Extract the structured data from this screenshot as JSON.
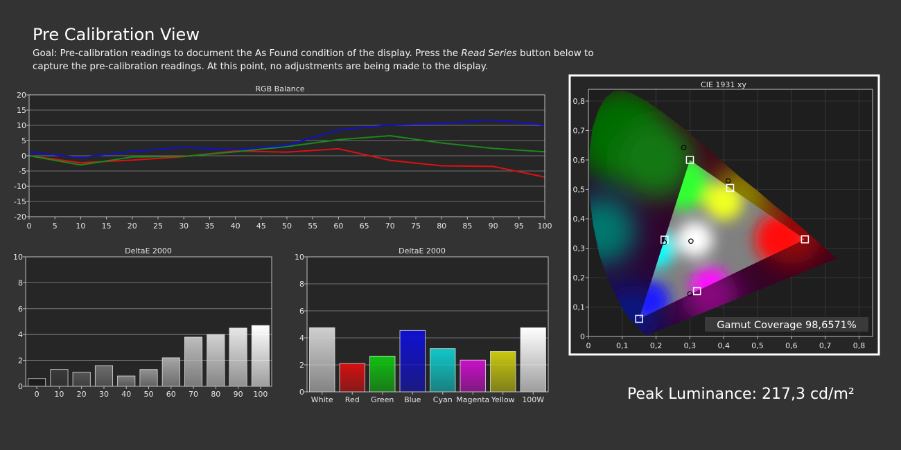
{
  "page": {
    "title": "Pre Calibration View",
    "goal_prefix": "Goal: Pre-calibration readings to document the As Found condition of the display. Press the ",
    "goal_emph": "Read Series",
    "goal_suffix": " button below to capture the pre-calibration readings. At this point, no adjustments are being made to the display.",
    "peak_luminance": "Peak Luminance: 217,3 cd/m²"
  },
  "colors": {
    "background": "#333333",
    "plot_bg": "#262626",
    "red_line": "#e01010",
    "green_line": "#1a8a1a",
    "blue_line": "#1010d0"
  },
  "chart_data": [
    {
      "type": "line",
      "title": "RGB Balance",
      "x": [
        0,
        10,
        20,
        30,
        40,
        50,
        60,
        70,
        80,
        90,
        100
      ],
      "xticks": [
        "0",
        "5",
        "10",
        "15",
        "20",
        "25",
        "30",
        "35",
        "40",
        "45",
        "50",
        "55",
        "60",
        "65",
        "70",
        "75",
        "80",
        "85",
        "90",
        "95",
        "100"
      ],
      "yticks": [
        "20",
        "15",
        "10",
        "5",
        "0",
        "-5",
        "-10",
        "-15",
        "-20"
      ],
      "xlim": [
        0,
        100
      ],
      "ylim": [
        -20,
        20
      ],
      "grid": true,
      "series": [
        {
          "color": "#e01010",
          "values": [
            0,
            -2.3,
            -1.4,
            -0.3,
            1.6,
            1.2,
            2.3,
            -1.5,
            -3.3,
            -3.5,
            -7.0
          ]
        },
        {
          "color": "#1a8a1a",
          "values": [
            0,
            -3.0,
            -0.4,
            -0.2,
            1.3,
            3.0,
            5.3,
            6.6,
            4.2,
            2.4,
            1.3
          ]
        },
        {
          "color": "#1010d0",
          "values": [
            1.2,
            -0.6,
            1.4,
            2.8,
            2.0,
            3.4,
            8.5,
            10.1,
            10.6,
            11.7,
            10.1
          ]
        }
      ]
    },
    {
      "type": "bar",
      "title": "DeltaE 2000",
      "categories": [
        "0",
        "10",
        "20",
        "30",
        "40",
        "50",
        "60",
        "70",
        "80",
        "90",
        "100"
      ],
      "values": [
        0.6,
        1.3,
        1.1,
        1.6,
        0.8,
        1.3,
        2.2,
        3.8,
        4.0,
        4.5,
        4.7
      ],
      "yticks": [
        "10",
        "8",
        "6",
        "4",
        "2",
        "0"
      ],
      "ylim": [
        0,
        10
      ],
      "colors": [
        "#1a1a1a",
        "#3a3a3a",
        "#555555",
        "#6c6c6c",
        "#7e7e7e",
        "#919191",
        "#a6a6a6",
        "#bdbdbd",
        "#d2d2d2",
        "#e6e6e6",
        "#ffffff"
      ],
      "grid": true
    },
    {
      "type": "bar",
      "title": "DeltaE 2000",
      "categories": [
        "White",
        "Red",
        "Green",
        "Blue",
        "Cyan",
        "Magenta",
        "Yellow",
        "100W"
      ],
      "values": [
        4.75,
        2.1,
        2.65,
        4.55,
        3.2,
        2.35,
        3.0,
        4.75
      ],
      "yticks": [
        "10",
        "8",
        "6",
        "4",
        "2",
        "0"
      ],
      "ylim": [
        0,
        10
      ],
      "colors": [
        "#cfcfcf",
        "#d41010",
        "#10c010",
        "#1010d0",
        "#10c8c8",
        "#c810c8",
        "#c8c810",
        "#ffffff"
      ],
      "grid": true
    },
    {
      "type": "scatter",
      "title": "CIE 1931 xy",
      "xticks": [
        "0",
        "0,1",
        "0,2",
        "0,3",
        "0,4",
        "0,5",
        "0,6",
        "0,7",
        "0,8"
      ],
      "yticks": [
        "0,8",
        "0,7",
        "0,6",
        "0,5",
        "0,4",
        "0,3",
        "0,2",
        "0,1",
        "0"
      ],
      "xlim": [
        0,
        0.84
      ],
      "ylim": [
        0,
        0.84
      ],
      "gamut_coverage": "Gamut Coverage 98,6571%",
      "targets": [
        {
          "x": 0.64,
          "y": 0.33
        },
        {
          "x": 0.3,
          "y": 0.6
        },
        {
          "x": 0.15,
          "y": 0.06
        },
        {
          "x": 0.225,
          "y": 0.329
        },
        {
          "x": 0.321,
          "y": 0.154
        },
        {
          "x": 0.419,
          "y": 0.505
        },
        {
          "x": 0.3127,
          "y": 0.329
        }
      ],
      "measured": [
        {
          "x": 0.282,
          "y": 0.642
        },
        {
          "x": 0.413,
          "y": 0.529
        },
        {
          "x": 0.224,
          "y": 0.32
        },
        {
          "x": 0.303,
          "y": 0.324
        },
        {
          "x": 0.3,
          "y": 0.145
        }
      ]
    }
  ]
}
